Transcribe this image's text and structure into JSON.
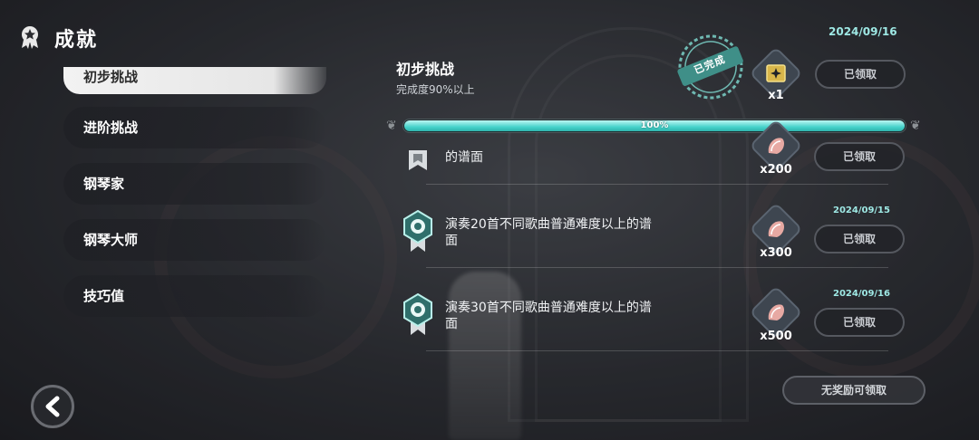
{
  "header": {
    "title": "成就",
    "icon": "achievement-ribbon-icon"
  },
  "sidebar": {
    "items": [
      {
        "label": "初步挑战",
        "active": true
      },
      {
        "label": "进阶挑战"
      },
      {
        "label": "钢琴家"
      },
      {
        "label": "钢琴大师"
      },
      {
        "label": "技巧值"
      }
    ]
  },
  "summary": {
    "date": "2024/09/16",
    "title": "初步挑战",
    "subtitle": "完成度90%以上",
    "stamp": "已完成",
    "reward_qty": "x1",
    "reward_icon": "golden-sparkle-card-icon",
    "claim_label": "已领取"
  },
  "progress": {
    "percent": 100,
    "label": "100%"
  },
  "achievements": [
    {
      "text": "的谱面",
      "reward_qty": "x200",
      "claim_label": "已领取",
      "reward_icon": "seashell-icon"
    },
    {
      "date": "2024/09/15",
      "text": "演奏20首不同歌曲普通难度以上的谱面",
      "reward_qty": "x300",
      "claim_label": "已领取",
      "reward_icon": "seashell-icon"
    },
    {
      "date": "2024/09/16",
      "text": "演奏30首不同歌曲普通难度以上的谱面",
      "reward_qty": "x500",
      "claim_label": "已领取",
      "reward_icon": "seashell-icon"
    }
  ],
  "footer": {
    "no_reward_label": "无奖励可领取"
  },
  "colors": {
    "accent": "#47d3cb",
    "date": "#9ee8e4"
  }
}
